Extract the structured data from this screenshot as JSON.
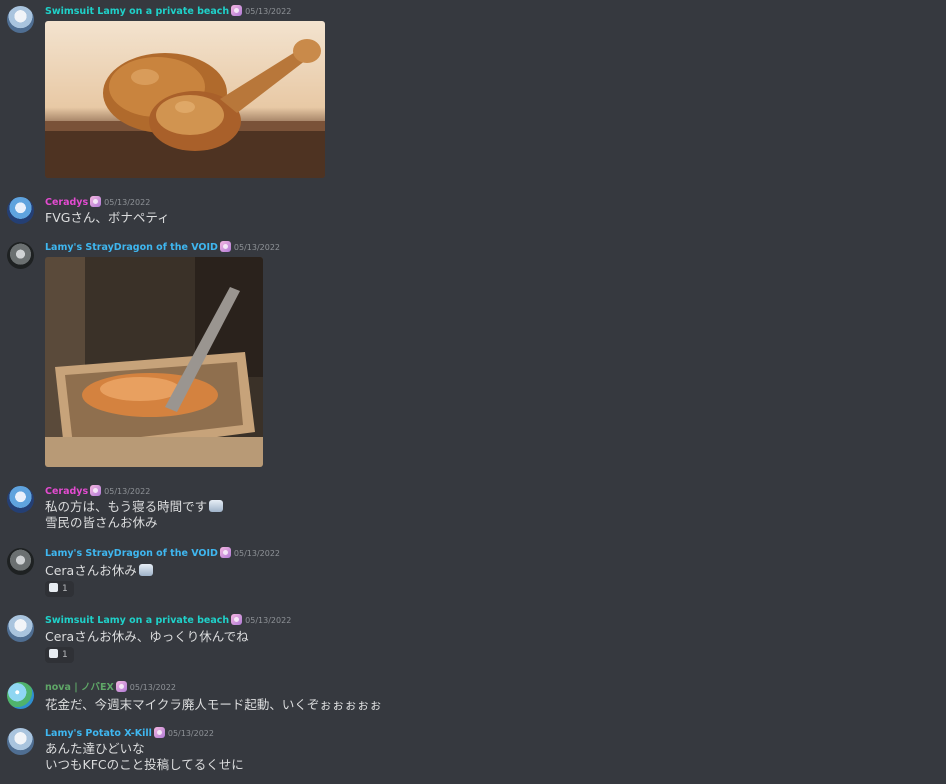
{
  "messages": [
    {
      "author": "Swimsuit Lamy on a private beach",
      "author_color": "#1fd1c9",
      "timestamp": "05/13/2022",
      "avatar_icon": "lamy-avatar",
      "attachment": "fried-chicken-image"
    },
    {
      "author": "Ceradys",
      "author_color": "#e34bd0",
      "timestamp": "05/13/2022",
      "avatar_icon": "ceradys-avatar",
      "lines": [
        "FVGさん、ボナペティ"
      ]
    },
    {
      "author": "Lamy's StrayDragon of the VOID",
      "author_color": "#3fb7f0",
      "timestamp": "05/13/2022",
      "avatar_icon": "dragon-avatar",
      "attachment": "deep-fryer-gif"
    },
    {
      "author": "Ceradys",
      "author_color": "#e34bd0",
      "timestamp": "05/13/2022",
      "avatar_icon": "ceradys-avatar",
      "lines": [
        "私の方は、もう寝る時間です",
        "雪民の皆さんお休み"
      ]
    },
    {
      "author": "Lamy's StrayDragon of the VOID",
      "author_color": "#3fb7f0",
      "timestamp": "05/13/2022",
      "avatar_icon": "dragon-avatar",
      "lines": [
        "Ceraさんお休み"
      ],
      "reaction": {
        "emoji": "snowman-emoji",
        "count": "1"
      }
    },
    {
      "author": "Swimsuit Lamy on a private beach",
      "author_color": "#1fd1c9",
      "timestamp": "05/13/2022",
      "avatar_icon": "lamy-avatar",
      "lines": [
        "Ceraさんお休み、ゆっくり休んでね"
      ],
      "reaction": {
        "emoji": "snowman-emoji",
        "count": "1"
      }
    },
    {
      "author": "nova | ノバEX",
      "author_color": "#5fa667",
      "timestamp": "05/13/2022",
      "avatar_icon": "nova-avatar",
      "lines": [
        "花金だ、今週末マイクラ廃人モード起動、いくぞぉぉぉぉぉ"
      ]
    },
    {
      "author": "Lamy's Potato X-Kill",
      "author_color": "#3fb7f0",
      "timestamp": "05/13/2022",
      "avatar_icon": "lamy-avatar",
      "lines": [
        "あんた達ひどいな",
        "いつもKFCのこと投稿してるくせに"
      ]
    }
  ]
}
